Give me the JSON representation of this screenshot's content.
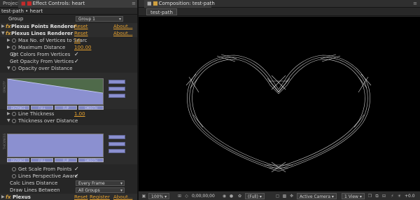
{
  "left_panel": {
    "tabs": {
      "project": "Project",
      "effect_controls": "Effect Controls: heart"
    },
    "breadcrumb": "test-path • heart",
    "rows": {
      "group_label": "Group",
      "group_value": "Group 1",
      "points_renderer": "Plexus Points Renderer",
      "points_reset": "Reset",
      "points_about": "About...",
      "lines_renderer": "Plexus Lines Renderer",
      "lines_reset": "Reset",
      "lines_about": "About...",
      "max_vertices_label": "Max No. of Vertices to Searc",
      "max_vertices_value": "10",
      "max_distance_label": "Maximum Distance",
      "max_distance_value": "100.00",
      "colors_label": "Get Colors From Vertices",
      "opacity_vertices_label": "Get Opacity From Vertices",
      "opacity_distance_label": "Opacity over Distance",
      "line_thickness_label": "Line Thickness",
      "line_thickness_value": "1.00",
      "thickness_distance_label": "Thickness over Distance",
      "scale_points_label": "Get Scale From Points",
      "perspective_label": "Lines Perspective Aware",
      "calc_distance_label": "Calc Lines Distance",
      "calc_distance_value": "Every Frame",
      "draw_between_label": "Draw Lines Between",
      "draw_between_value": "All Groups",
      "plexus_label": "Plexus",
      "plexus_reset": "Reset",
      "plexus_register": "Register",
      "plexus_about": "About..."
    },
    "graph_buttons": [
      "DISTANCE",
      "FULL",
      "FLIP",
      "SMOOTH"
    ],
    "graph_side_label": "OPACITY",
    "graph2_side_label": "THICKNESS"
  },
  "comp_panel": {
    "tab": "Composition: test-path",
    "sub_tab": "test-path",
    "bottom": {
      "zoom": "100%",
      "timecode": "0;00;00;00",
      "resolution": "(Full)",
      "camera": "Active Camera",
      "view": "1 View",
      "exposure": "+0.0"
    }
  },
  "colors": {
    "accent": "#e6a12e",
    "graph_fill": "#8b90d0",
    "graph_green": "#4f6a4a"
  }
}
